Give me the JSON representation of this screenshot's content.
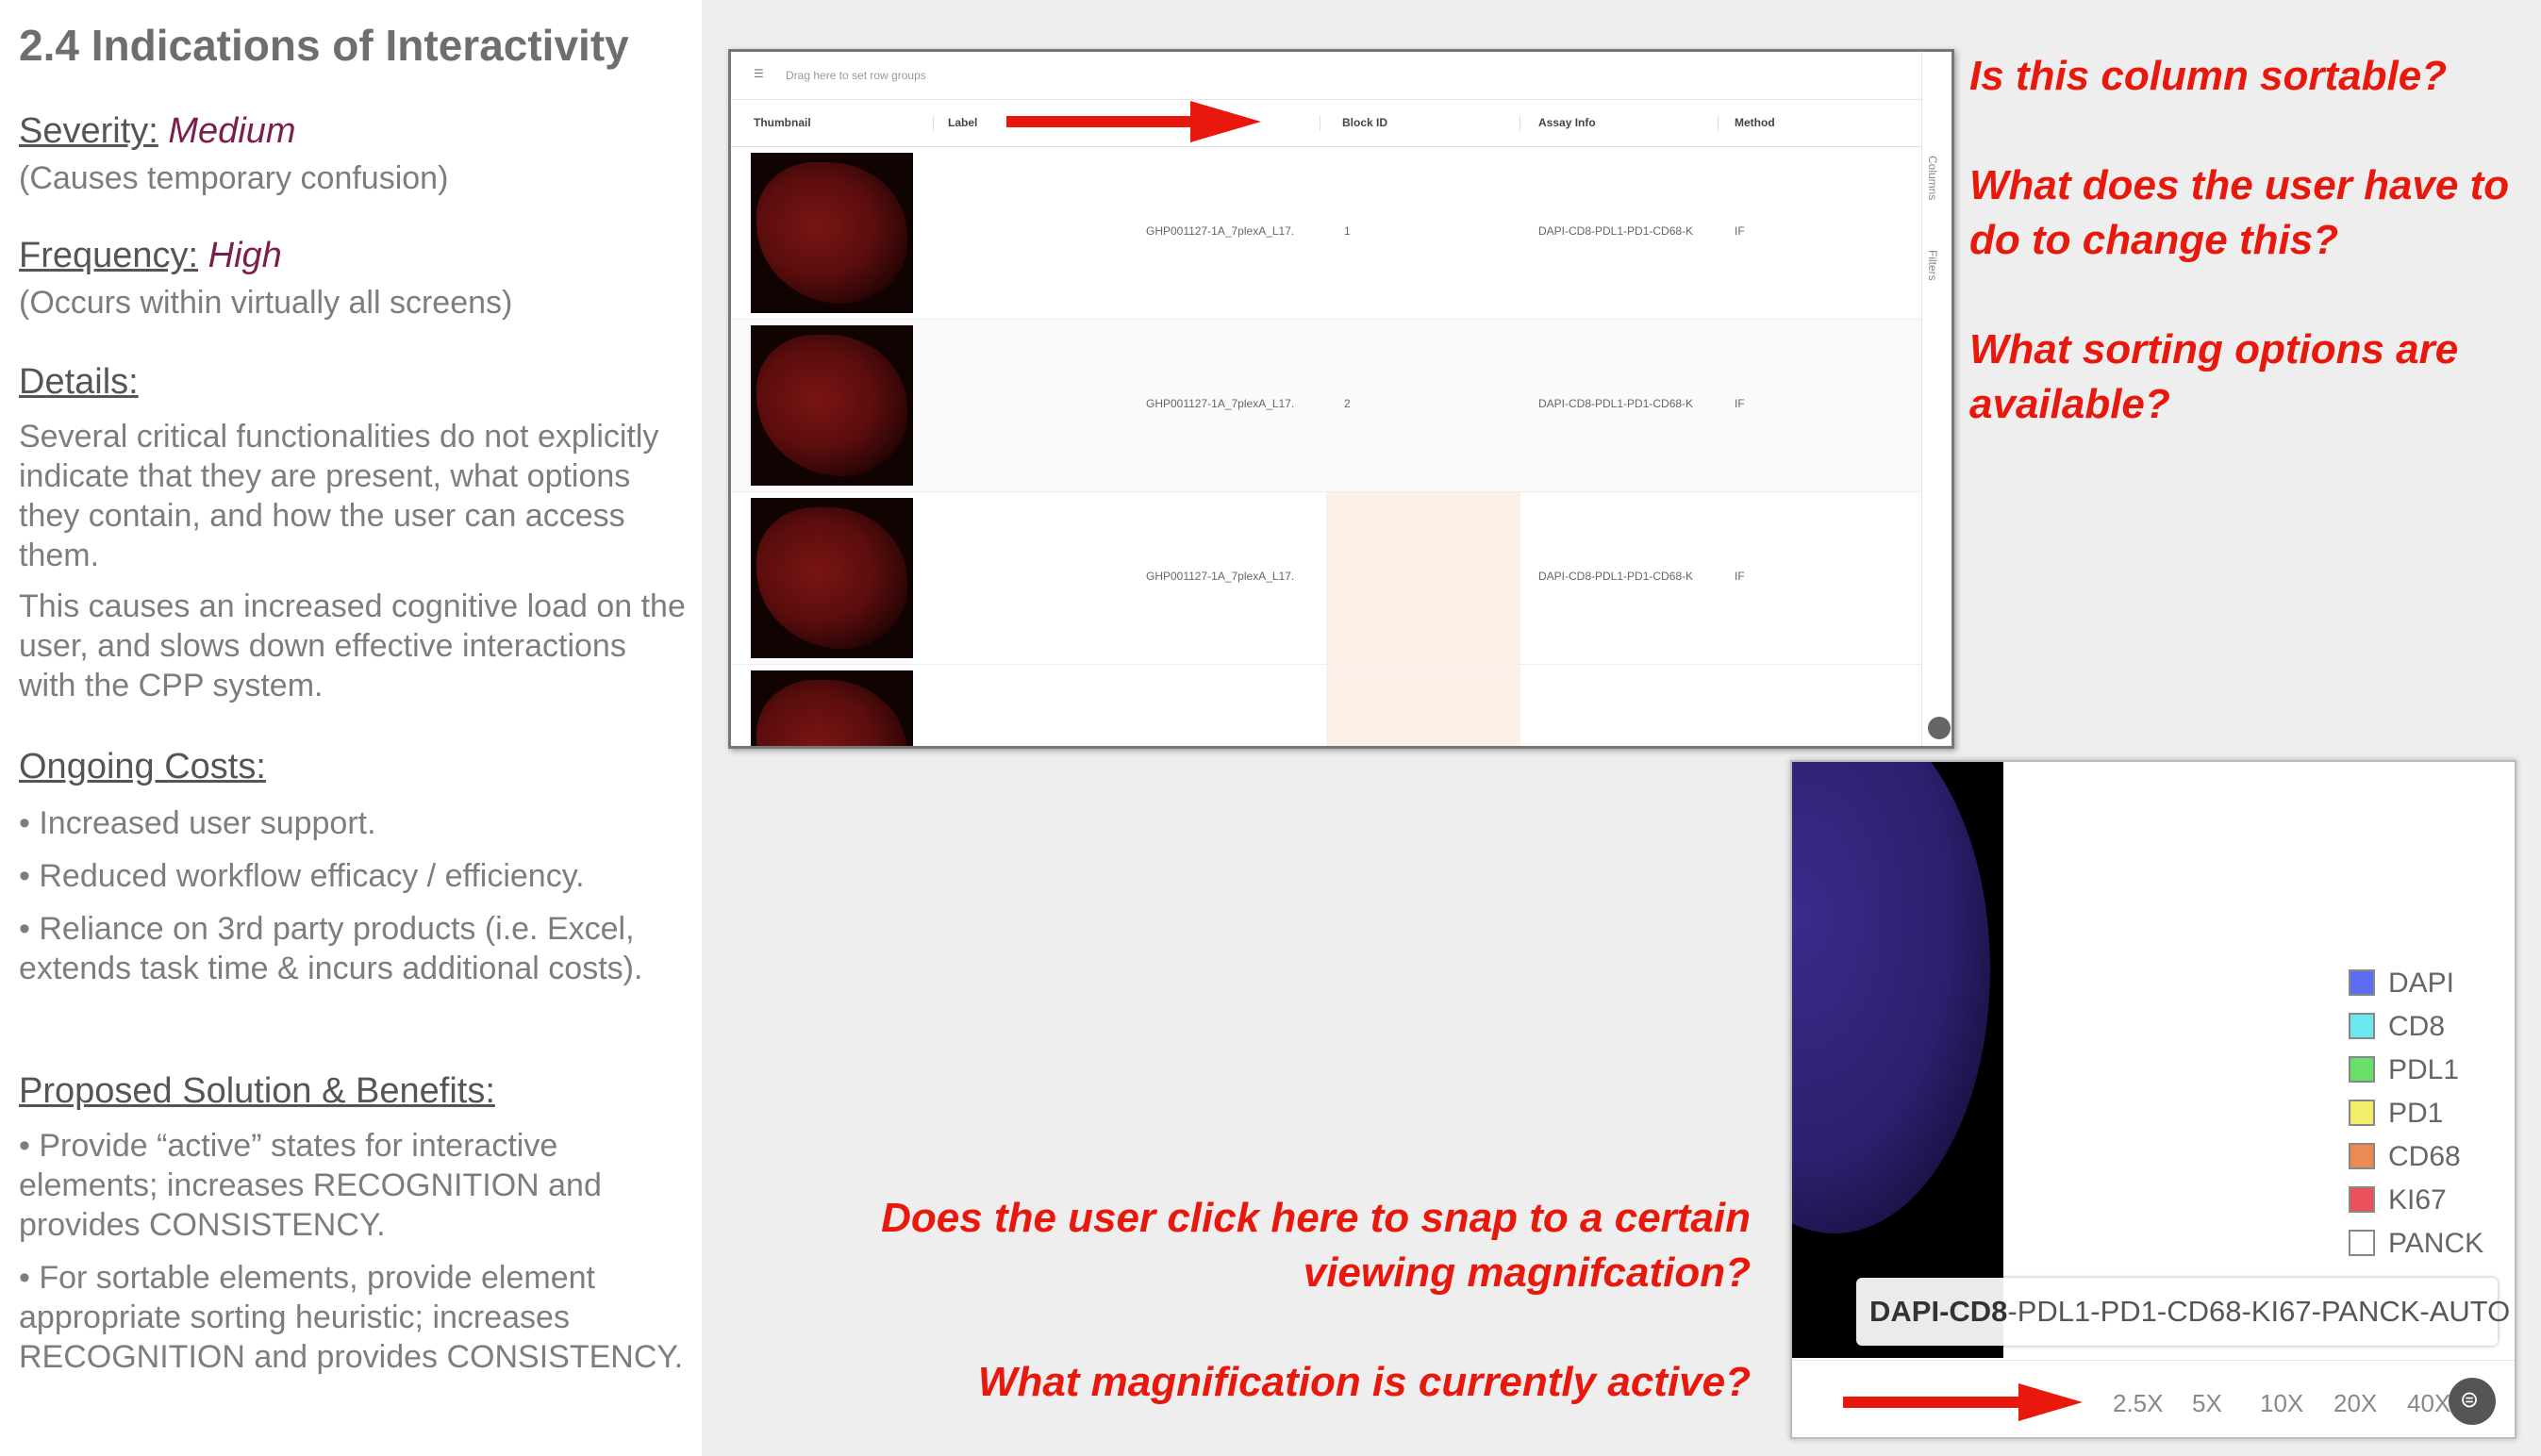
{
  "slide": {
    "title": "2.4 Indications of Interactivity",
    "severity_label": "Severity:",
    "severity_value": "Medium",
    "severity_note": "(Causes temporary confusion)",
    "frequency_label": "Frequency:",
    "frequency_value": "High",
    "frequency_note": "(Occurs within virtually all screens)",
    "details_heading": "Details:",
    "details_p1": "Several critical functionalities do not explicitly indicate that they are present, what options they contain, and how the user can access them.",
    "details_p2": "This causes an increased cognitive load on the user, and slows down effective interactions with the CPP system.",
    "costs_heading": "Ongoing Costs:",
    "costs": [
      "• Increased user support.",
      "• Reduced workflow efficacy / efficiency.",
      "• Reliance on 3rd party products (i.e. Excel, extends task time & incurs additional costs)."
    ],
    "solution_heading": "Proposed Solution & Benefits:",
    "solutions": [
      "• Provide “active” states for interactive elements; increases RECOGNITION and provides CONSISTENCY.",
      "• For sortable elements, provide element appropriate sorting heuristic; increases RECOGNITION and provides CONSISTENCY."
    ]
  },
  "questions_top": [
    "Is this column sortable?",
    "What does the user have to do to change this?",
    "What sorting options are available?"
  ],
  "questions_bottom": [
    "Does the user click here to snap to a certain viewing magnifcation?",
    "What magnification is currently active?"
  ],
  "table": {
    "toolbar_text": "Drag here to set row groups",
    "headers": [
      "Thumbnail",
      "Label",
      "Block ID",
      "Assay Info",
      "Method"
    ],
    "rows": [
      {
        "label": "GHP001127-1A_7plexA_L17.",
        "block": "1",
        "assay": "DAPI-CD8-PDL1-PD1-CD68-K",
        "method": "IF"
      },
      {
        "label": "GHP001127-1A_7plexA_L17.",
        "block": "2",
        "assay": "DAPI-CD8-PDL1-PD1-CD68-K",
        "method": "IF"
      },
      {
        "label": "GHP001127-1A_7plexA_L17.",
        "block": "",
        "assay": "DAPI-CD8-PDL1-PD1-CD68-K",
        "method": "IF"
      }
    ],
    "side_columns": "Columns",
    "side_filters": "Filters"
  },
  "viewer": {
    "legend": [
      {
        "label": "DAPI",
        "color": "#5a6cf0"
      },
      {
        "label": "CD8",
        "color": "#6ee8ef"
      },
      {
        "label": "PDL1",
        "color": "#69e06a"
      },
      {
        "label": "PD1",
        "color": "#f3ee6a"
      },
      {
        "label": "CD68",
        "color": "#ec8a55"
      },
      {
        "label": "KI67",
        "color": "#e8505a"
      },
      {
        "label": "PANCK",
        "color": "#ffffff"
      }
    ],
    "assay_bold": "DAPI-CD8",
    "assay_rest": "-PDL1-PD1-CD68-KI67-PANCK-AUTO",
    "magnifications": [
      "2.5X",
      "5X",
      "10X",
      "20X",
      "40X"
    ]
  },
  "colors": {
    "accent": "#e8180c",
    "highlight": "#7b1e4c"
  }
}
